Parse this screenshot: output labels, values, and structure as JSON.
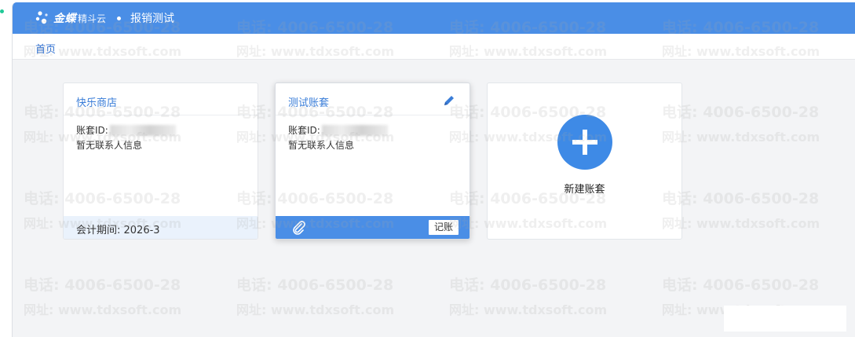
{
  "header": {
    "brand_main": "金蝶",
    "brand_sub": "精斗云",
    "app_title": "报销测试"
  },
  "nav": {
    "home": "首页"
  },
  "accounts": [
    {
      "name": "快乐商店",
      "id_label": "账套ID:",
      "contact": "暂无联系人信息",
      "period": "会计期间:  2026-3"
    },
    {
      "name": "测试账套",
      "id_label": "账套ID:",
      "contact": "暂无联系人信息",
      "action_label": "记账"
    }
  ],
  "new_account": {
    "label": "新建账套"
  },
  "watermark": {
    "phone": "电话: 4006-6500-28",
    "site": "网址: www.tdxsoft.com"
  },
  "colors": {
    "primary": "#4a8ee6",
    "accent_text": "#3a7dd8",
    "status_green": "#20c997"
  }
}
